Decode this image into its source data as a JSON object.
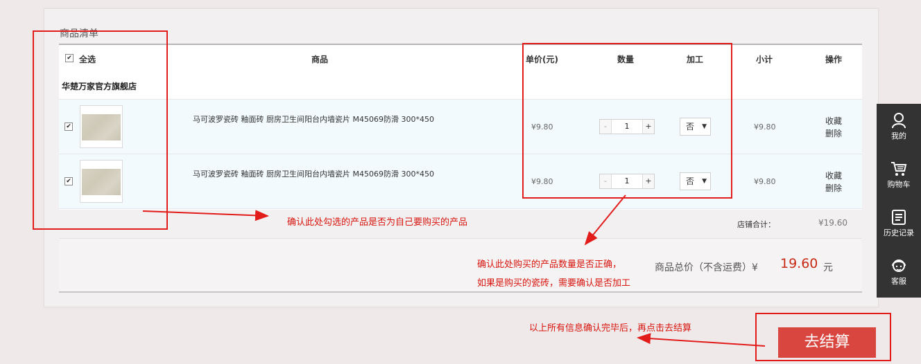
{
  "cart": {
    "section_title": "商品清单",
    "headers": {
      "select_all": "全选",
      "product": "商品",
      "unit_price": "单价(元)",
      "quantity": "数量",
      "processing": "加工",
      "subtotal": "小计",
      "actions": "操作"
    },
    "store_name": "华楚万家官方旗舰店",
    "items": [
      {
        "name": "马可波罗瓷砖 釉面砖 厨房卫生间阳台内墙瓷片 M45069防滑 300*450",
        "price": "¥9.80",
        "qty_minus": "-",
        "qty": "1",
        "qty_plus": "+",
        "processing": "否",
        "subtotal": "¥9.80",
        "favorite": "收藏",
        "delete": "删除",
        "checked": true
      },
      {
        "name": "马可波罗瓷砖 釉面砖 厨房卫生间阳台内墙瓷片 M45069防滑 300*450",
        "price": "¥9.80",
        "qty_minus": "-",
        "qty": "1",
        "qty_plus": "+",
        "processing": "否",
        "subtotal": "¥9.80",
        "favorite": "收藏",
        "delete": "删除",
        "checked": true
      }
    ],
    "store_total_label": "店铺合计：",
    "store_total": "¥19.60",
    "total_label": "商品总价（不含运费）¥",
    "total_value": "19.60",
    "total_unit": "元",
    "checkout": "去结算"
  },
  "sidebar": [
    {
      "icon": "user-icon",
      "label": "我的"
    },
    {
      "icon": "cart-icon",
      "label": "购物车"
    },
    {
      "icon": "history-icon",
      "label": "历史记录"
    },
    {
      "icon": "customer-service-icon",
      "label": "客服"
    }
  ],
  "annotations": {
    "note1": "确认此处勾选的产品是否为自己要购买的产品",
    "note2_line1": "确认此处购买的产品数量是否正确，",
    "note2_line2": "如果是购买的瓷砖，需要确认是否加工",
    "note3": "以上所有信息确认完毕后，再点击去结算",
    "color": "#e21b1b"
  },
  "colors": {
    "accent": "#c72a15",
    "checkout_bg": "#d9463f",
    "sidebar_bg": "#333333"
  }
}
